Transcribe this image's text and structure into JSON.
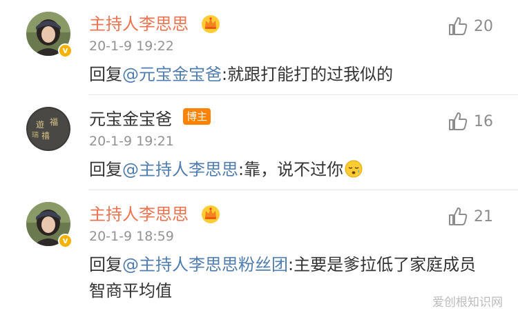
{
  "comments": [
    {
      "author": "主持人李思思",
      "time": "20-1-9 19:22",
      "likes": "20",
      "reply_prefix": "回复",
      "mention": "@元宝金宝爸",
      "text": ":就跟打能打的过我似的",
      "verified_badge": "v",
      "badge_icon": "crown-icon"
    },
    {
      "author": "元宝金宝爸",
      "author_badge": "博主",
      "time": "20-1-9 19:21",
      "likes": "16",
      "reply_prefix": "回复",
      "mention": "@主持人李思思",
      "text": ":靠，说不过你",
      "emoji": "sleepy-face-icon"
    },
    {
      "author": "主持人李思思",
      "time": "20-1-9 18:59",
      "likes": "21",
      "reply_prefix": "回复",
      "mention": "@主持人李思思粉丝团",
      "text": ":主要是爹拉低了家庭成员智商平均值",
      "verified_badge": "v",
      "badge_icon": "crown-icon"
    }
  ],
  "watermark": "爱创根知识网",
  "colors": {
    "vip_name": "#eb7350",
    "mention": "#507daf",
    "host_badge": "#ff8200",
    "verified": "#f5b300",
    "meta": "#939393"
  }
}
